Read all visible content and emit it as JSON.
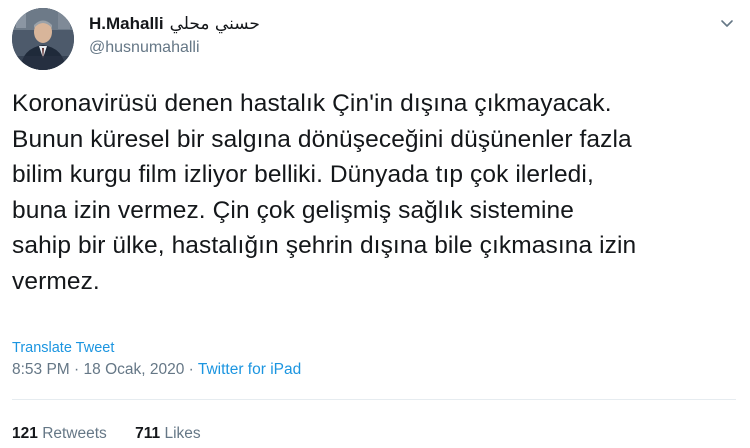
{
  "author": {
    "name": "H.Mahalli",
    "name_arabic": "حسني محلي",
    "handle": "@husnumahalli",
    "avatar_icon": "profile-photo"
  },
  "tweet": {
    "lines": [
      "Koronavirüsü denen hastalık Çin'in dışına çıkmayacak.",
      "Bunun küresel bir salgına dönüşeceğini düşünenler fazla",
      "bilim kurgu film izliyor belliki. Dünyada tıp çok ilerledi,",
      "buna izin vermez. Çin çok gelişmiş sağlık sistemine",
      "sahip bir ülke, hastalığın şehrin dışına bile çıkmasına izin",
      "vermez."
    ]
  },
  "translate_label": "Translate Tweet",
  "meta": {
    "time": "8:53 PM",
    "separator": " · ",
    "date": "18 Ocak, 2020",
    "source": "Twitter for iPad"
  },
  "stats": {
    "retweets_count": "121",
    "retweets_label": "Retweets",
    "likes_count": "711",
    "likes_label": "Likes"
  },
  "colors": {
    "link": "#1b95e0",
    "secondary": "#657786",
    "text": "#14171a"
  }
}
